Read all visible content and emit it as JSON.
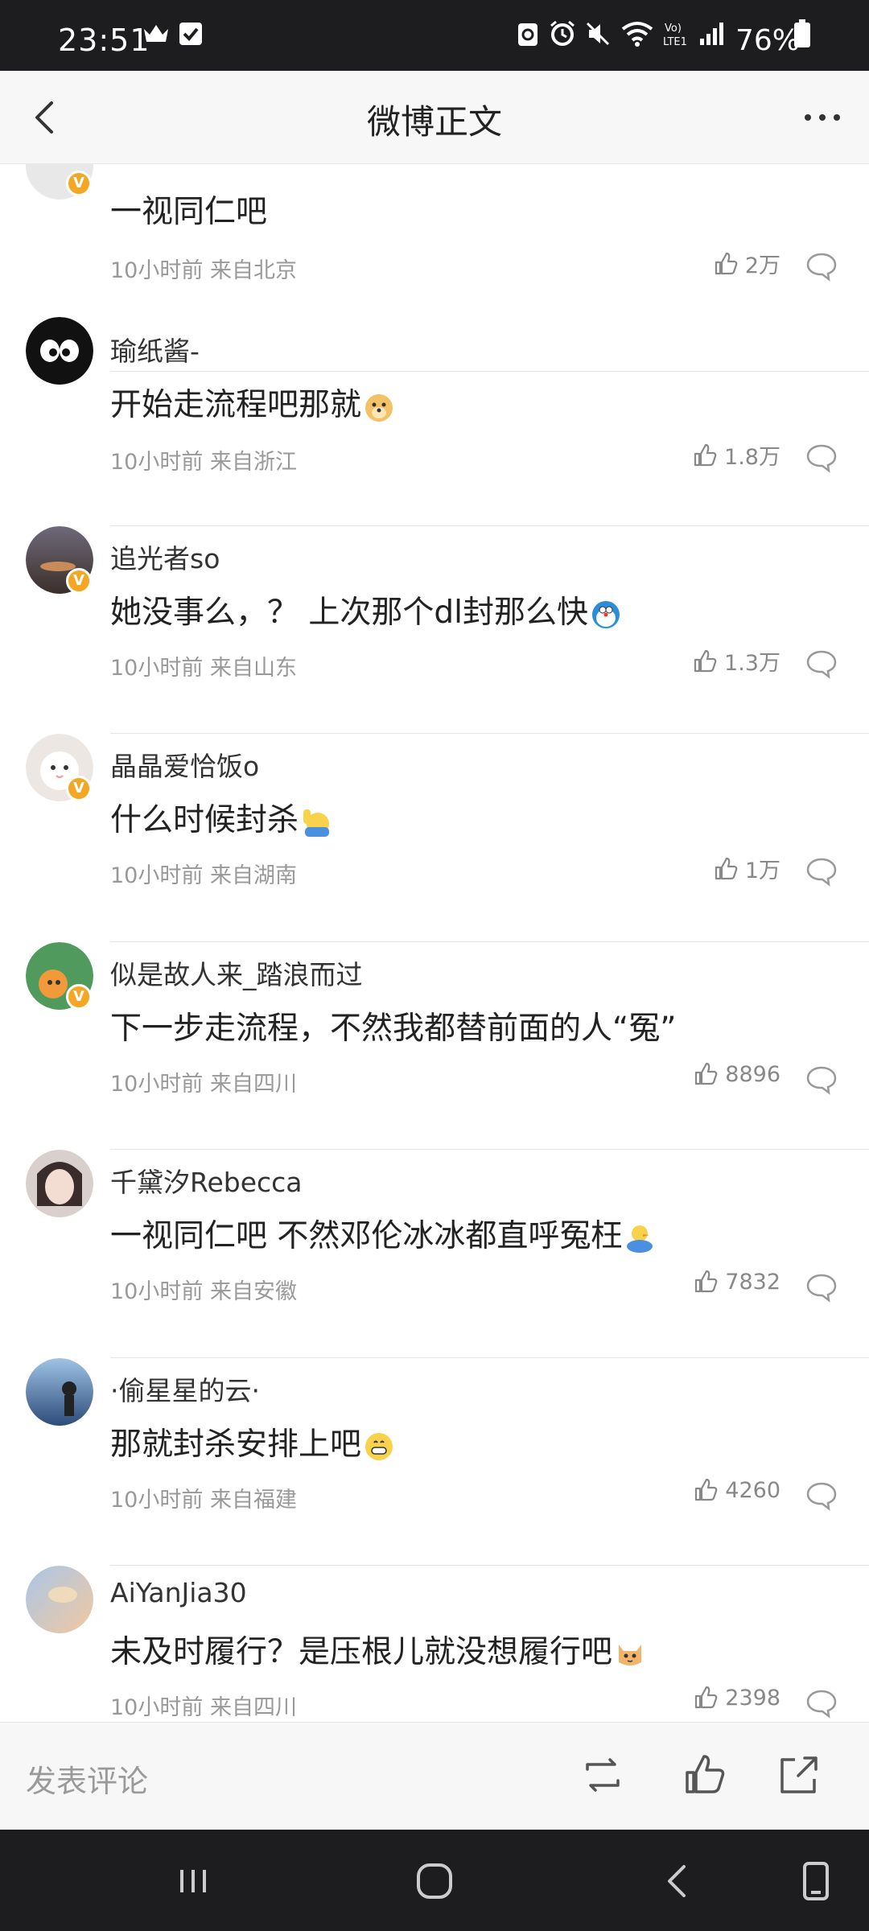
{
  "status_bar": {
    "time": "23:51",
    "battery": "76%",
    "icons": [
      "crown-icon",
      "check-box-icon",
      "recycle-icon",
      "alarm-icon",
      "mute-icon",
      "wifi-icon",
      "volte-icon",
      "signal-icon",
      "battery-icon"
    ]
  },
  "nav": {
    "title": "微博正文",
    "back_icon": "chevron-left-icon",
    "more_icon": "more-dots-icon"
  },
  "comments": [
    {
      "user": "",
      "text": "一视同仁吧",
      "emoji": "",
      "time": "10小时前",
      "source": "来自北京",
      "likes": "2万",
      "verified": true
    },
    {
      "user": "瑜纸酱-",
      "text": "开始走流程吧那就",
      "emoji": "doge-emoji",
      "time": "10小时前",
      "source": "来自浙江",
      "likes": "1.8万",
      "verified": false
    },
    {
      "user": "追光者so",
      "text": "她没事么，？ 上次那个dl封那么快",
      "emoji": "doraemon-emoji",
      "time": "10小时前",
      "source": "来自山东",
      "likes": "1.3万",
      "verified": true
    },
    {
      "user": "晶晶爱恰饭o",
      "text": "什么时候封杀",
      "emoji": "raise-hand-emoji",
      "time": "10小时前",
      "source": "来自湖南",
      "likes": "1万",
      "verified": true
    },
    {
      "user": "似是故人来_踏浪而过",
      "text": "下一步走流程，不然我都替前面的人“冤”",
      "emoji": "",
      "time": "10小时前",
      "source": "来自四川",
      "likes": "8896",
      "verified": true
    },
    {
      "user": "千黛汐Rebecca",
      "text": "一视同仁吧 不然邓伦冰冰都直呼冤枉",
      "emoji": "duck-emoji",
      "time": "10小时前",
      "source": "来自安徽",
      "likes": "7832",
      "verified": false
    },
    {
      "user": "·偷星星的云·",
      "text": "那就封杀安排上吧",
      "emoji": "grin-emoji",
      "time": "10小时前",
      "source": "来自福建",
      "likes": "4260",
      "verified": false
    },
    {
      "user": "AiYanJia30",
      "text": "未及时履行？是压根儿就没想履行吧",
      "emoji": "cat-emoji",
      "time": "10小时前",
      "source": "来自四川",
      "likes": "2398",
      "verified": false
    }
  ],
  "input_bar": {
    "placeholder": "发表评论",
    "icons": [
      "repost-icon",
      "like-icon",
      "share-icon"
    ]
  },
  "system_nav": {
    "icons": [
      "recents-icon",
      "home-icon",
      "back-icon",
      "keyboard-icon"
    ]
  },
  "colors": {
    "status_bg": "#1d1d1f",
    "badge": "#f5a623",
    "meta_text": "#999999"
  }
}
